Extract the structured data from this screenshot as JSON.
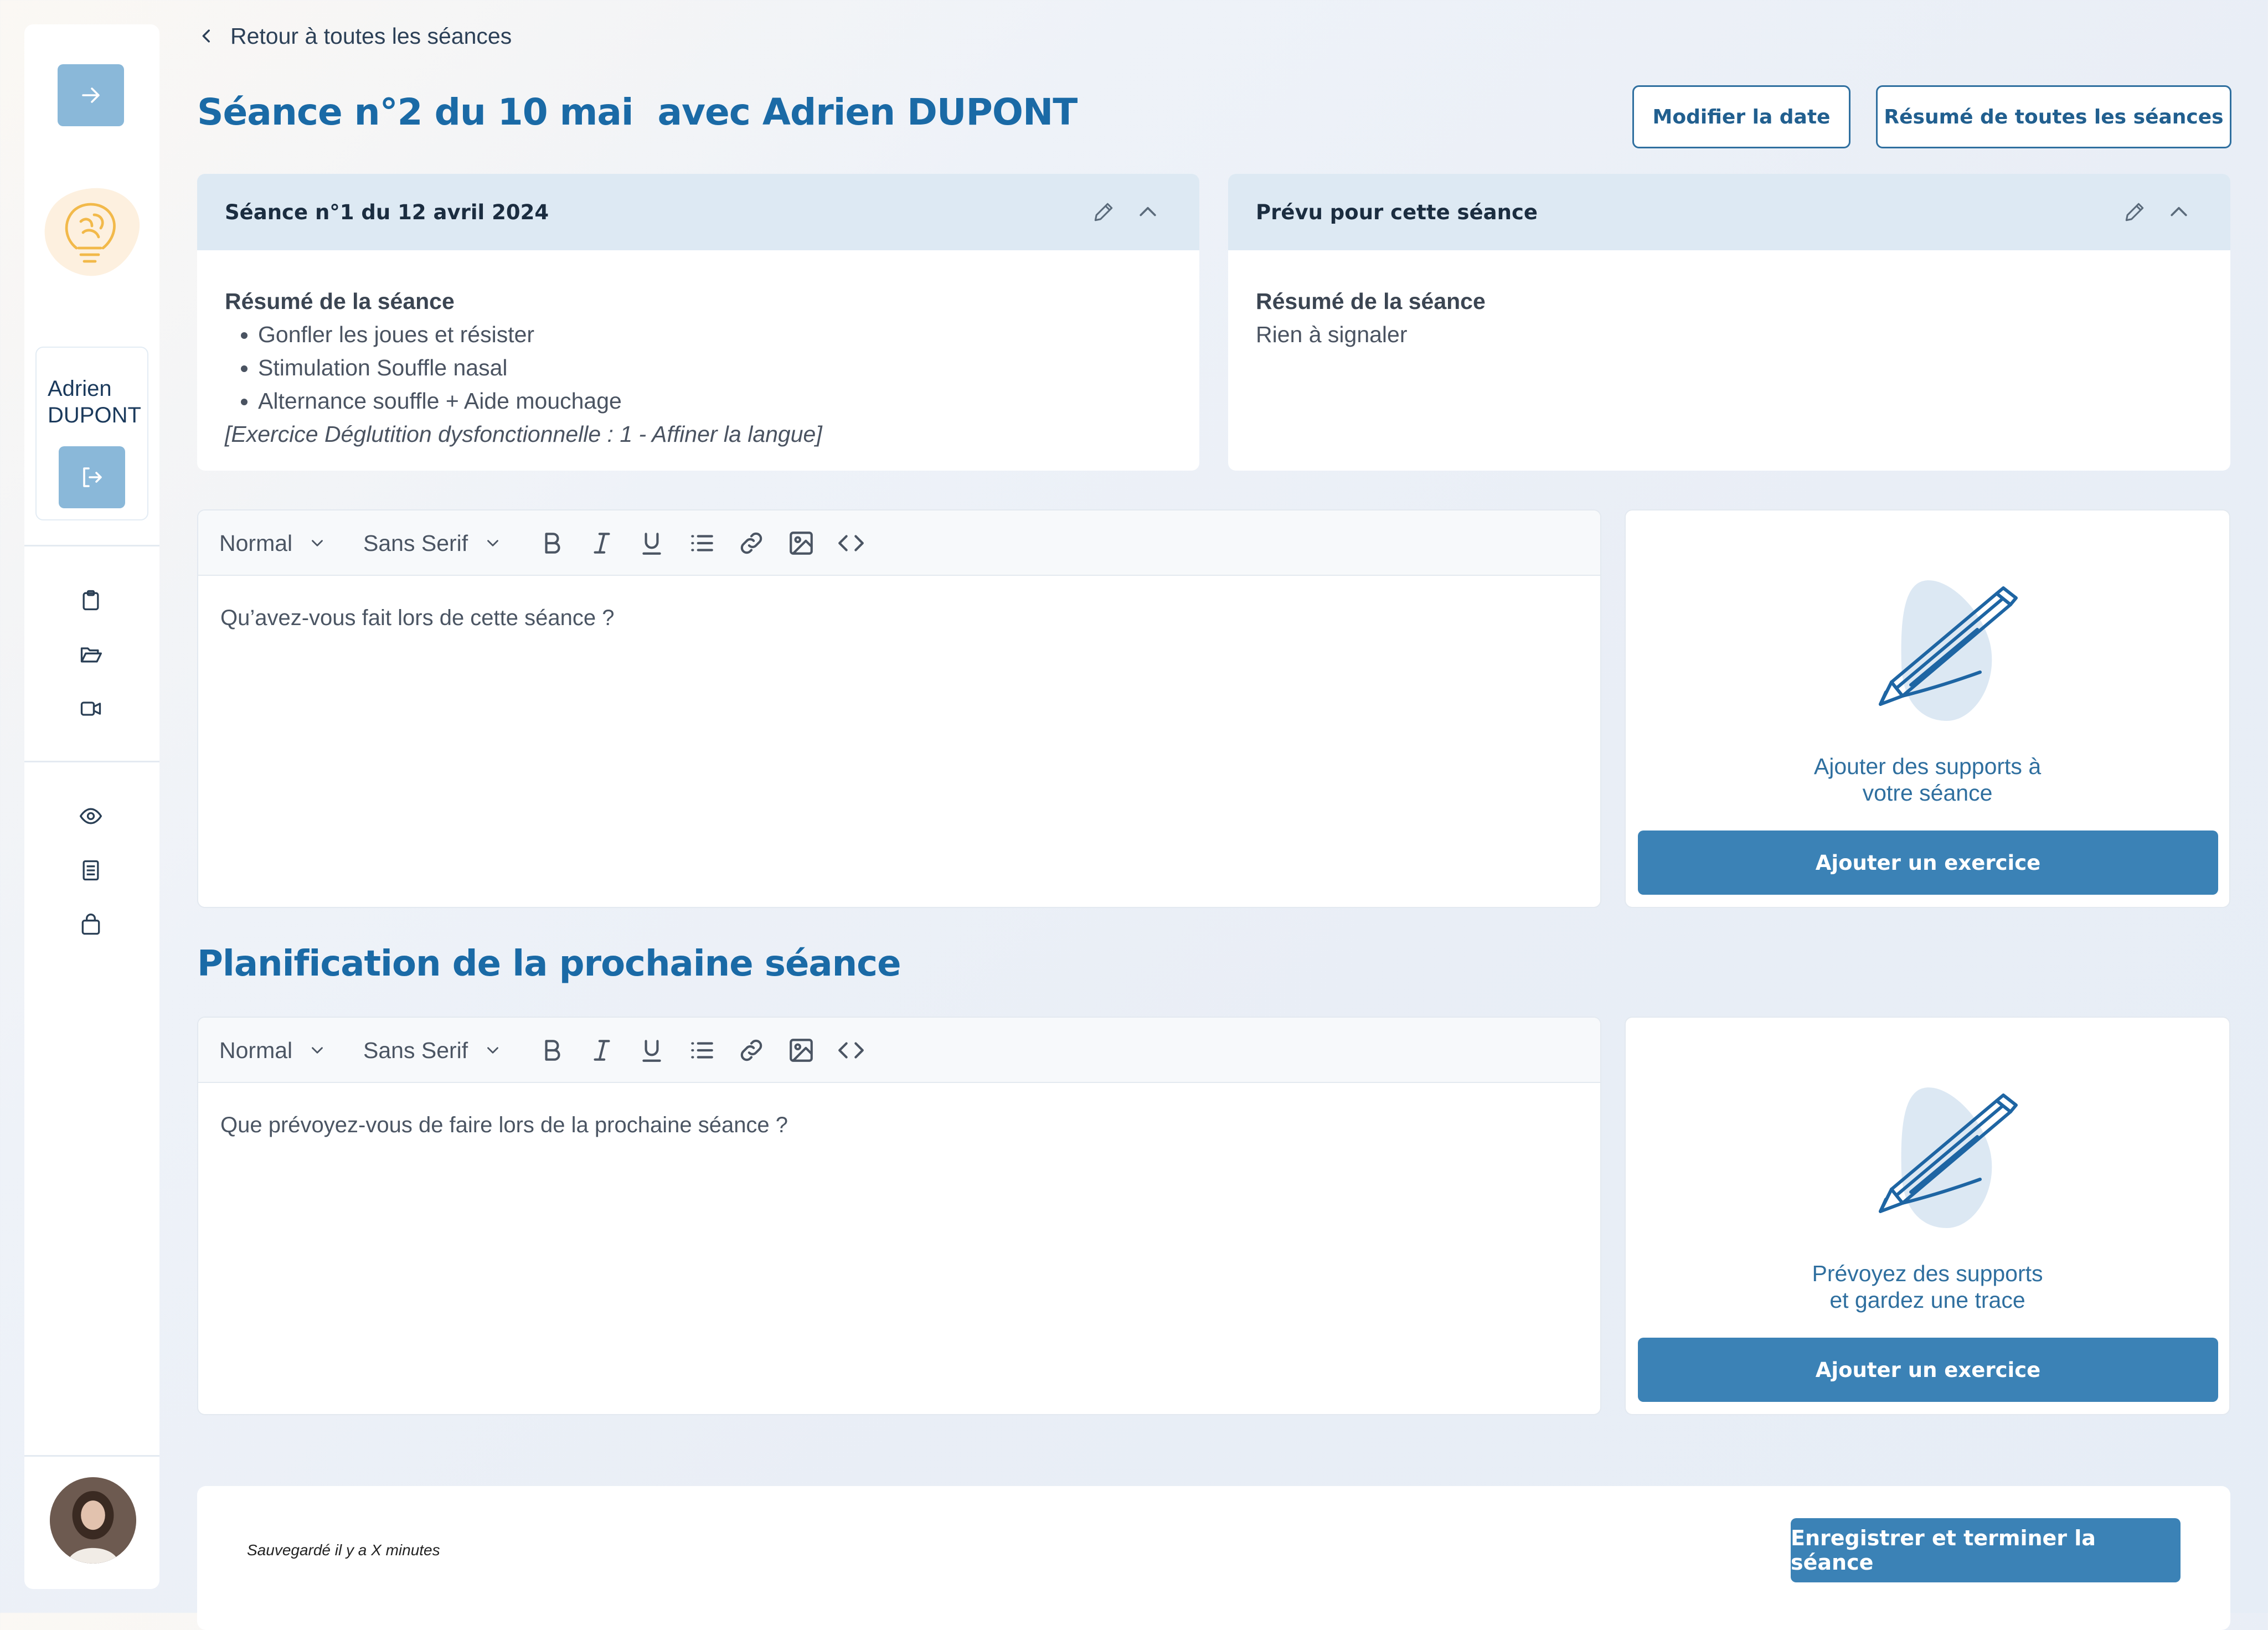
{
  "nav": {
    "back_label": "Retour à toutes les séances"
  },
  "header": {
    "title": "Séance n°2 du 10 mai  avec Adrien DUPONT",
    "modify_date_label": "Modifier la date",
    "summary_all_label": "Résumé de toutes les séances"
  },
  "sidebar": {
    "user_first": "Adrien",
    "user_last": "DUPONT",
    "icons": [
      "arrow-right-icon",
      "brain-bulb-logo",
      "logout-icon",
      "clipboard-icon",
      "folder-open-icon",
      "video-icon",
      "eye-icon",
      "book-icon",
      "shopping-bag-icon",
      "avatar"
    ]
  },
  "previous_session": {
    "title": "Séance n°1 du 12 avril 2024",
    "summary_heading": "Résumé de la séance",
    "items": [
      "Gonfler les joues et résister",
      "Stimulation Souffle nasal",
      "Alternance souffle + Aide mouchage"
    ],
    "exercise_note": "[Exercice Déglutition dysfonctionnelle : 1 - Affiner la langue]"
  },
  "planned": {
    "title": "Prévu pour cette séance",
    "summary_heading": "Résumé de la séance",
    "summary_text": "Rien à signaler"
  },
  "editor_current": {
    "format": "Normal",
    "font": "Sans Serif",
    "placeholder": "Qu’avez-vous fait lors de cette séance ?"
  },
  "support_current": {
    "line1": "Ajouter des supports à",
    "line2": "votre séance",
    "button": "Ajouter un exercice"
  },
  "planning": {
    "section_title": "Planification de la prochaine séance"
  },
  "editor_next": {
    "format": "Normal",
    "font": "Sans Serif",
    "placeholder": "Que prévoyez-vous de faire lors de la prochaine séance ?"
  },
  "support_next": {
    "line1": "Prévoyez des supports",
    "line2": "et gardez une trace",
    "button": "Ajouter un exercice"
  },
  "footer": {
    "saved_text": "Sauvegardé il y a X minutes",
    "save_button": "Enregistrer et terminer la séance"
  },
  "colors": {
    "primary": "#1a6aa6",
    "button": "#3b82b6",
    "card_header": "#dde9f3"
  }
}
